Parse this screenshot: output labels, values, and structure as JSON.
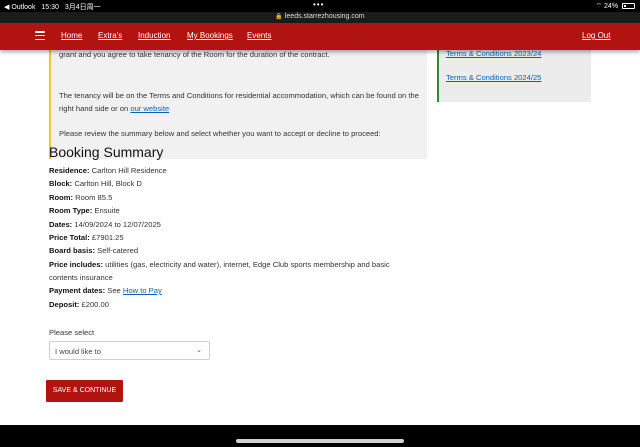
{
  "status_bar": {
    "back_app": "◀ Outlook",
    "time": "15:30",
    "date": "3月4日周一",
    "wifi": "⌔",
    "battery": "24%",
    "battery_level": 0.24
  },
  "browser": {
    "url": "leeds.starrezhousing.com"
  },
  "nav": {
    "home": "Home",
    "extras": "Extra's",
    "induction": "Induction",
    "my_bookings": "My Bookings",
    "events": "Events",
    "logout": "Log Out"
  },
  "notice": {
    "para1": "grant and you agree to take tenancy of the Room for the duration of the contract.",
    "para2_prefix": "The tenancy will be on the Terms and Conditions for residential accommodation, which can be found on the right hand side or on ",
    "para2_link": "our website",
    "para3": "Please review the summary below and select whether you want to accept or decline to proceed:"
  },
  "sidebar": {
    "terms": [
      "Terms & Conditions 2023/24",
      "Terms & Conditions 2024/25"
    ]
  },
  "summary": {
    "title": "Booking Summary",
    "residence_label": "Residence:",
    "residence": "Carlton Hill Residence",
    "block_label": "Block:",
    "block": "Carlton Hill, Block D",
    "room_label": "Room:",
    "room": "Room 85.5",
    "room_type_label": "Room Type:",
    "room_type": "Ensuite",
    "dates_label": "Dates:",
    "dates": "14/09/2024 to 12/07/2025",
    "price_total_label": "Price Total:",
    "price_total": "£7901.25",
    "board_label": "Board basis:",
    "board": "Self-catered",
    "includes_label": "Price includes:",
    "includes_line1": "utilities (gas, electricity and water), internet, Edge Club sports membership and basic",
    "includes_line2": "contents insurance",
    "payment_label": "Payment dates:",
    "payment_prefix": "See",
    "payment_link": "How to Pay",
    "deposit_label": "Deposit:",
    "deposit": "£200.00"
  },
  "form": {
    "select_label": "Please select",
    "select_value": "I would like to",
    "save_button": "SAVE & CONTINUE"
  }
}
